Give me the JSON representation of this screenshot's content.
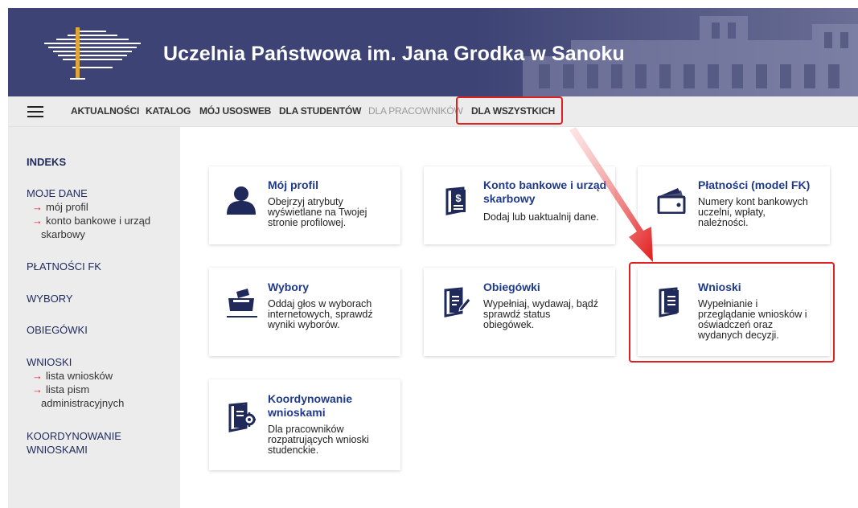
{
  "header": {
    "title": "Uczelnia Państwowa im. Jana Grodka w Sanoku"
  },
  "nav": {
    "items": [
      {
        "label": "AKTUALNOŚCI",
        "disabled": false
      },
      {
        "label": "KATALOG",
        "disabled": false
      },
      {
        "label": "MÓJ USOSWEB",
        "disabled": false
      },
      {
        "label": "DLA STUDENTÓW",
        "disabled": false
      },
      {
        "label": "DLA PRACOWNIKÓW",
        "disabled": true
      },
      {
        "label": "DLA WSZYSTKICH",
        "disabled": false
      }
    ]
  },
  "sidebar": {
    "indeks": "INDEKS",
    "moje_dane": "MOJE DANE",
    "moje_dane_items": [
      "mój profil",
      "konto bankowe i urząd",
      "skarbowy"
    ],
    "platnosci": "PŁATNOŚCI FK",
    "wybory": "WYBORY",
    "obiegowki": "OBIEGÓWKI",
    "wnioski": "WNIOSKI",
    "wnioski_items": [
      "lista wniosków",
      "lista pism",
      "administracyjnych"
    ],
    "koordynowanie": [
      "KOORDYNOWANIE",
      "WNIOSKAMI"
    ]
  },
  "tiles": {
    "profil": {
      "title": "Mój profil",
      "desc": [
        "Obejrzyj atrybuty",
        "wyświetlane na Twojej",
        "stronie profilowej."
      ]
    },
    "konto": {
      "title": [
        "Konto bankowe i urząd",
        "skarbowy"
      ],
      "desc": [
        "Dodaj lub uaktualnij dane."
      ]
    },
    "platnosci": {
      "title": "Płatności (model FK)",
      "desc": [
        "Numery kont bankowych",
        "uczelni, wpłaty,",
        "należności."
      ]
    },
    "wybory": {
      "title": "Wybory",
      "desc": [
        "Oddaj głos w wyborach",
        "internetowych, sprawdź",
        "wyniki wyborów."
      ]
    },
    "obiegowki": {
      "title": "Obiegówki",
      "desc": [
        "Wypełniaj, wydawaj, bądź",
        "sprawdź status",
        "obiegówek."
      ]
    },
    "wnioski": {
      "title": "Wnioski",
      "desc": [
        "Wypełnianie i",
        "przeglądanie wniosków i",
        "oświadczeń oraz",
        "wydanych decyzji."
      ]
    },
    "koordynowanie": {
      "title": [
        "Koordynowanie",
        "wnioskami"
      ],
      "desc": [
        "Dla pracowników",
        "rozpatrujących wnioski",
        "studenckie."
      ]
    }
  },
  "colors": {
    "header_bg": "#3d4374",
    "tile_title": "#1f3a8a",
    "icon": "#1f2a5a",
    "highlight": "#e02020"
  }
}
